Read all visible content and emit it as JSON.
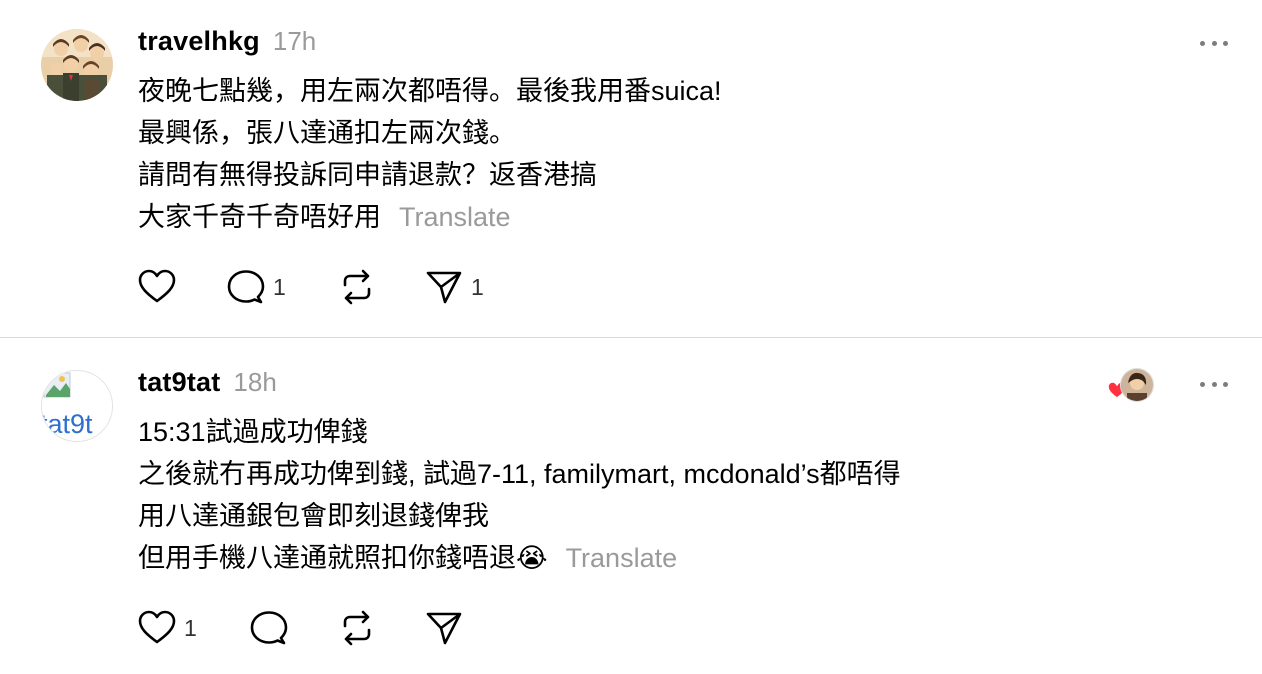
{
  "posts": [
    {
      "username": "travelhkg",
      "time": "17h",
      "lines": [
        "夜晚七點幾，用左兩次都唔得。最後我用番suica!",
        "最興係，張八達通扣左兩次錢。",
        "請問有無得投訴同申請退款？返香港搞",
        "大家千奇千奇唔好用"
      ],
      "translate_label": "Translate",
      "like_count": "",
      "reply_count": "1",
      "share_count": "1",
      "avatar_icon": "group-photo-avatar"
    },
    {
      "username": "tat9tat",
      "time": "18h",
      "lines": [
        "15:31試過成功俾錢",
        "之後就冇再成功俾到錢, 試過7-11, familymart, mcdonald’s都唔得",
        "用八達通銀包會即刻退錢俾我",
        "但用手機八達通就照扣你錢唔退😭"
      ],
      "translate_label": "Translate",
      "like_count": "1",
      "reply_count": "",
      "share_count": "",
      "avatar_text": "tat9t",
      "avatar_icon": "broken-image-avatar"
    }
  ],
  "colors": {
    "muted": "#9a9a9a",
    "heart": "#ff3040",
    "divider": "#d9d9d9"
  }
}
